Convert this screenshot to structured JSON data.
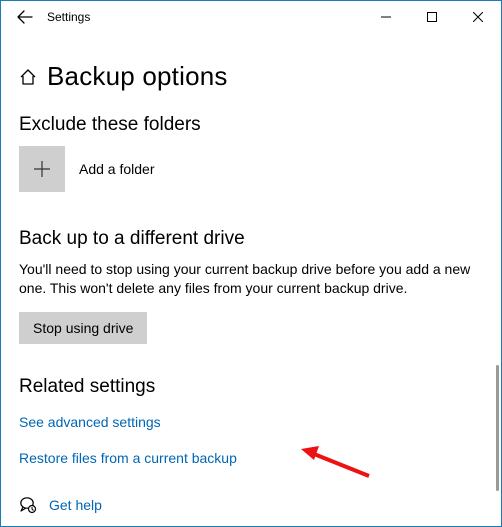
{
  "titlebar": {
    "app_name": "Settings"
  },
  "page": {
    "title": "Backup options"
  },
  "exclude": {
    "heading": "Exclude these folders",
    "add_label": "Add a folder"
  },
  "different_drive": {
    "heading": "Back up to a different drive",
    "description": "You'll need to stop using your current backup drive before you add a new one. This won't delete any files from your current backup drive.",
    "button": "Stop using drive"
  },
  "related": {
    "heading": "Related settings",
    "advanced_link": "See advanced settings",
    "restore_link": "Restore files from a current backup"
  },
  "help": {
    "label": "Get help"
  }
}
